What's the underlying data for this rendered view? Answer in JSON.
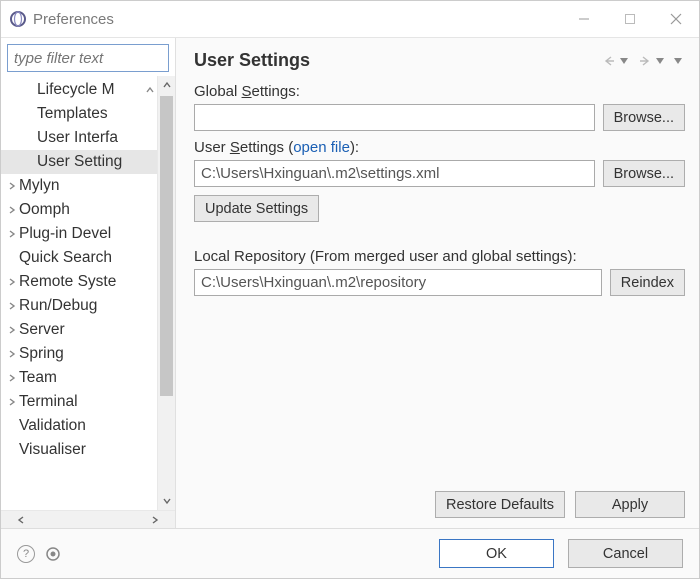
{
  "window": {
    "title": "Preferences"
  },
  "sidebar": {
    "filter_placeholder": "type filter text",
    "items": [
      {
        "label": "Lifecycle M",
        "depth": 2,
        "expandable": false
      },
      {
        "label": "Templates",
        "depth": 2,
        "expandable": false
      },
      {
        "label": "User Interfa",
        "depth": 2,
        "expandable": false
      },
      {
        "label": "User Setting",
        "depth": 2,
        "expandable": false,
        "selected": true
      },
      {
        "label": "Mylyn",
        "depth": 1,
        "expandable": true
      },
      {
        "label": "Oomph",
        "depth": 1,
        "expandable": true
      },
      {
        "label": "Plug-in Devel",
        "depth": 1,
        "expandable": true
      },
      {
        "label": "Quick Search",
        "depth": 1,
        "expandable": false
      },
      {
        "label": "Remote Syste",
        "depth": 1,
        "expandable": true
      },
      {
        "label": "Run/Debug",
        "depth": 1,
        "expandable": true
      },
      {
        "label": "Server",
        "depth": 1,
        "expandable": true
      },
      {
        "label": "Spring",
        "depth": 1,
        "expandable": true
      },
      {
        "label": "Team",
        "depth": 1,
        "expandable": true
      },
      {
        "label": "Terminal",
        "depth": 1,
        "expandable": true
      },
      {
        "label": "Validation",
        "depth": 1,
        "expandable": false
      },
      {
        "label": "Visualiser",
        "depth": 1,
        "expandable": false
      }
    ]
  },
  "page": {
    "title": "User Settings",
    "global_label_pre": "Global ",
    "global_label_u": "S",
    "global_label_post": "ettings:",
    "global_value": "",
    "browse1": "Browse...",
    "user_label_pre": "User ",
    "user_label_u": "S",
    "user_label_post": "ettings (",
    "user_link": "open file",
    "user_label_close": "):",
    "user_value": "C:\\Users\\Hxinguan\\.m2\\settings.xml",
    "browse2": "Browse...",
    "update_btn": "Update Settings",
    "local_repo_label": "Local Repository (From merged user and global settings):",
    "local_repo_value": "C:\\Users\\Hxinguan\\.m2\\repository",
    "reindex": "Reindex",
    "restore": "Restore Defaults",
    "apply": "Apply"
  },
  "footer": {
    "ok": "OK",
    "cancel": "Cancel"
  }
}
